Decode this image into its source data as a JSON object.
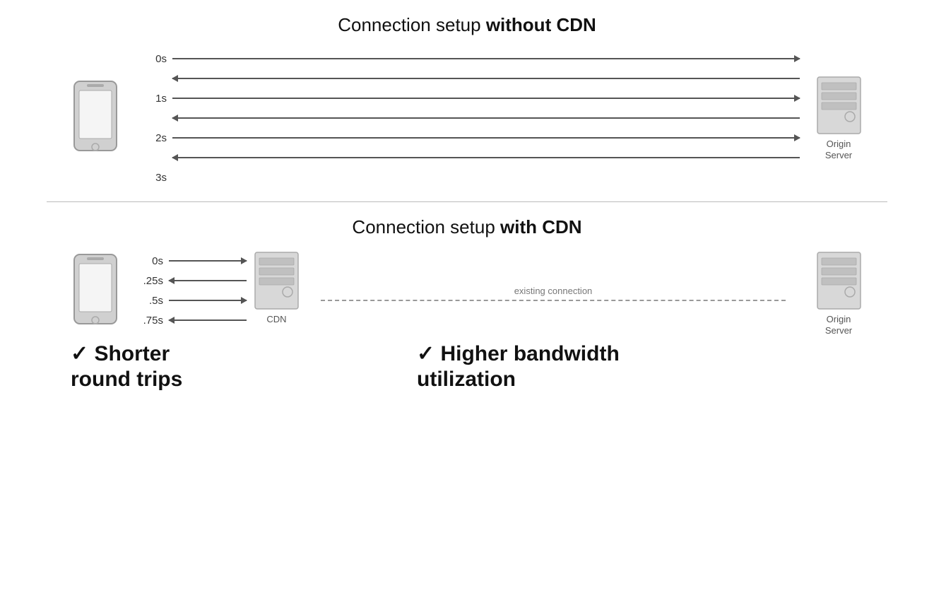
{
  "top_section": {
    "title_normal": "Connection setup ",
    "title_bold": "without CDN",
    "arrows": [
      {
        "time": "0s",
        "direction": "right"
      },
      {
        "time": "",
        "direction": "left"
      },
      {
        "time": "1s",
        "direction": "right"
      },
      {
        "time": "",
        "direction": "left"
      },
      {
        "time": "2s",
        "direction": "right"
      },
      {
        "time": "",
        "direction": "left"
      },
      {
        "time": "3s",
        "direction": "none"
      }
    ],
    "server_label": "Origin\nServer"
  },
  "bottom_section": {
    "title_normal": "Connection setup ",
    "title_bold": "with CDN",
    "cdn_arrows": [
      {
        "time": "0s",
        "direction": "right"
      },
      {
        "time": ".25s",
        "direction": "left"
      },
      {
        "time": ".5s",
        "direction": "right"
      },
      {
        "time": ".75s",
        "direction": "left"
      }
    ],
    "cdn_label": "CDN",
    "existing_connection": "existing connection",
    "server_label": "Origin\nServer",
    "benefit1_check": "✓",
    "benefit1_text": "Shorter\nround trips",
    "benefit2_check": "✓",
    "benefit2_text": "Higher bandwidth\nutilization"
  }
}
